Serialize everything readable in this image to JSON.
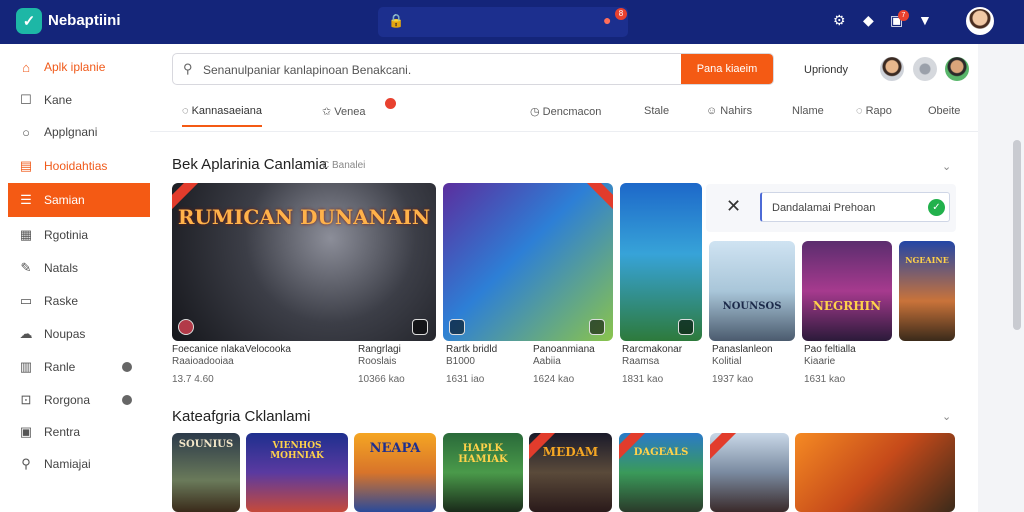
{
  "topbar": {
    "brand": "Nebaptiini",
    "search_badge": "8",
    "notif_badge": "7"
  },
  "sidebar": {
    "items": [
      {
        "label": "Aplk iplanie",
        "icon": "home-icon"
      },
      {
        "label": "Kane",
        "icon": "square-icon"
      },
      {
        "label": "Applgnani",
        "icon": "search-icon"
      },
      {
        "label": "Hooidahtias",
        "icon": "list-icon"
      },
      {
        "label": "Samian",
        "icon": "menu-icon"
      },
      {
        "label": "Rgotinia",
        "icon": "grid-icon"
      },
      {
        "label": "Natals",
        "icon": "pen-icon"
      },
      {
        "label": "Raske",
        "icon": "document-icon"
      },
      {
        "label": "Noupas",
        "icon": "cloud-icon"
      },
      {
        "label": "Ranle",
        "icon": "calendar-icon"
      },
      {
        "label": "Rorgona",
        "icon": "lock-icon"
      },
      {
        "label": "Rentra",
        "icon": "layout-icon"
      },
      {
        "label": "Namiajai",
        "icon": "search-icon"
      }
    ]
  },
  "search": {
    "placeholder": "Senanulpaniar kanlapinoan Benakcani.",
    "button": "Pana kiaeim"
  },
  "user_label": "Upriondy",
  "tabs": [
    {
      "label": "Kannasaeiana",
      "icon": "chat-icon"
    },
    {
      "label": "Venea",
      "icon": "star-icon"
    },
    {
      "label": "Dencmacon",
      "icon": "clock-icon"
    },
    {
      "label": "Stale",
      "icon": ""
    },
    {
      "label": "Nahirs",
      "icon": "smile-icon"
    },
    {
      "label": "Nlame",
      "icon": ""
    },
    {
      "label": "Rapo",
      "icon": "chat-icon"
    },
    {
      "label": "Obeite",
      "icon": ""
    }
  ],
  "section1": {
    "title": "Bek Aplarinia Canlamia",
    "subtitle": "C Banalei",
    "cards": [
      {
        "art": "RUMICAN DUNANAIN",
        "line1": "Foecanice nlakaVelocooka",
        "line2": "Raaioadooiaa",
        "meta": "13.7 4.60"
      },
      {
        "art": "",
        "line1": "Rangrlagi",
        "line2": "Rooslais",
        "meta": "10366 kao"
      },
      {
        "art": "",
        "line1": "Rartk bridld",
        "line2": "B1000",
        "meta": "1631 iao"
      },
      {
        "art": "",
        "line1": "Panoanmiana",
        "line2": "Aabiia",
        "meta": "1624 kao"
      },
      {
        "art": "",
        "line1": "Rarcmakonar",
        "line2": "Raamsa",
        "meta": "1831 kao"
      },
      {
        "art": "NOUNSOS",
        "line1": "Panaslanleon",
        "line2": "Kolitial",
        "meta": "1937 kao"
      },
      {
        "art": "NEGRHIN",
        "line1": "Pao feltialla",
        "line2": "Kiaarie",
        "meta": "1631 kao"
      },
      {
        "art": "NGEAINE",
        "line1": "",
        "line2": "",
        "meta": ""
      }
    ],
    "popup_field": "Dandalamai Prehoan"
  },
  "section2": {
    "title": "Kateafgria Cklanlami",
    "cards": [
      {
        "art": "SOUNIUS"
      },
      {
        "art": "VIENHOS MOHNIAK"
      },
      {
        "art": "NEAPA"
      },
      {
        "art": "HAPLK HAMIAK"
      },
      {
        "art": "MEDAM"
      },
      {
        "art": "DAGEALS"
      },
      {
        "art": ""
      },
      {
        "art": ""
      }
    ]
  },
  "colors": {
    "topbar": "#14257a",
    "accent": "#f45a14",
    "sidebar_highlight": "#f05a1a"
  }
}
